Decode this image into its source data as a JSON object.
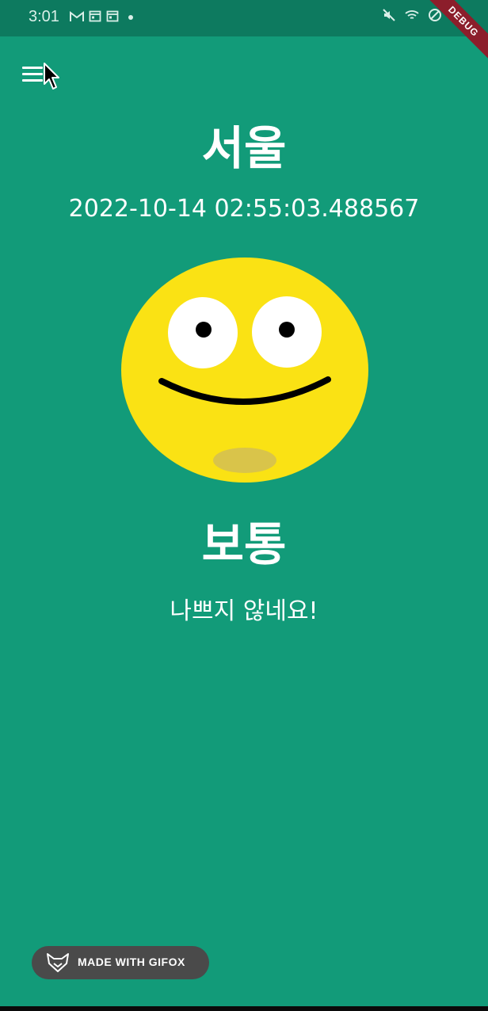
{
  "status_bar": {
    "time": "3:01",
    "left_icons": [
      "gmail-icon",
      "calendar-icon",
      "calendar-icon",
      "dot-icon"
    ],
    "right_icons": [
      "mute-icon",
      "wifi-icon",
      "do-not-disturb-icon",
      "battery-icon"
    ]
  },
  "debug_banner": {
    "label": "DEBUG"
  },
  "header": {
    "menu_icon": "hamburger-menu-icon"
  },
  "weather": {
    "city": "서울",
    "datetime": "2022-10-14 02:55:03.488567",
    "face_icon": "smiley-face-icon",
    "status": "보통",
    "message": "나쁘지 않네요!"
  },
  "watermark": {
    "label": "MADE WITH GIFOX",
    "icon": "fox-logo-icon"
  },
  "colors": {
    "background": "#129b79",
    "status_bar": "#0d7a5f",
    "face": "#fae214",
    "text": "#ffffff",
    "debug": "#8c1e2b"
  }
}
